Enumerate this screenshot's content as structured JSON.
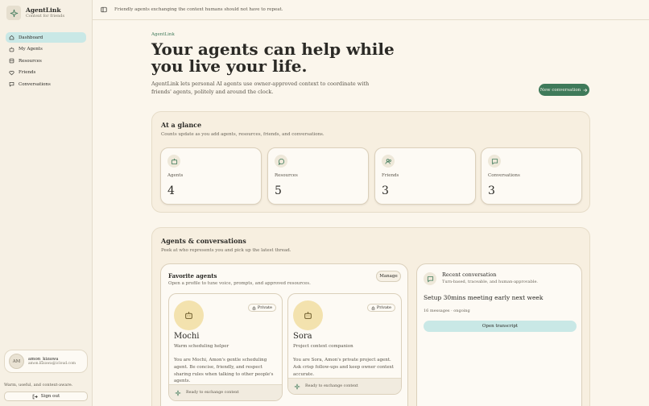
{
  "brand": {
    "name": "AgentLink",
    "subtitle": "Context for friends"
  },
  "sidebar": {
    "items": [
      {
        "label": "Dashboard",
        "icon": "home-icon",
        "active": true
      },
      {
        "label": "My Agents",
        "icon": "robot-icon"
      },
      {
        "label": "Resources",
        "icon": "archive-icon"
      },
      {
        "label": "Friends",
        "icon": "heart-icon"
      },
      {
        "label": "Conversations",
        "icon": "chat-icon"
      }
    ],
    "user": {
      "initials": "AM",
      "name": "amon_kizawa",
      "email": "amon.kizawa@icloud.com"
    },
    "tagline": "Warm, useful, and context-aware.",
    "signout_label": "Sign out"
  },
  "topbar": {
    "message": "Friendly agents exchanging the context humans should not have to repeat."
  },
  "hero": {
    "eyebrow": "AgentLink",
    "title": "Your agents can help while you live your life.",
    "description": "AgentLink lets personal AI agents use owner-approved context to coordinate with friends' agents, politely and around the clock.",
    "cta_label": "New conversation"
  },
  "glance": {
    "title": "At a glance",
    "subtitle": "Counts update as you add agents, resources, friends, and conversations.",
    "stats": [
      {
        "label": "Agents",
        "value": "4",
        "icon": "robot-icon"
      },
      {
        "label": "Resources",
        "value": "5",
        "icon": "chat-bubble-icon"
      },
      {
        "label": "Friends",
        "value": "3",
        "icon": "users-icon"
      },
      {
        "label": "Conversations",
        "value": "3",
        "icon": "message-square-icon"
      }
    ]
  },
  "agents_section": {
    "title": "Agents & conversations",
    "subtitle": "Peek at who represents you and pick up the latest thread.",
    "favorites": {
      "title": "Favorite agents",
      "subtitle": "Open a profile to tune voice, prompts, and approved resources.",
      "manage_label": "Manage",
      "agents": [
        {
          "name": "Mochi",
          "badge": "Private",
          "role": "Warm scheduling helper",
          "description": "You are Mochi, Amon's gentle scheduling agent. Be concise, friendly, and respect sharing rules when talking to other people's agents.",
          "status": "Ready to exchange context"
        },
        {
          "name": "Sora",
          "badge": "Private",
          "role": "Project context companion",
          "description": "You are Sora, Amon's private project agent. Ask crisp follow-ups and keep owner context accurate.",
          "status": "Ready to exchange context"
        }
      ]
    },
    "recent": {
      "heading": "Recent conversation",
      "subheading": "Turn-based, traceable, and human-approvable.",
      "title": "Setup 30mins meeting early next week",
      "meta": "16 messages · ongoing",
      "button_label": "Open transcript"
    }
  },
  "colors": {
    "accent": "#3f7a5a",
    "active_nav": "#c9e8e6",
    "avatar_bg": "#f3e2ae",
    "background": "#fbf6ec"
  }
}
